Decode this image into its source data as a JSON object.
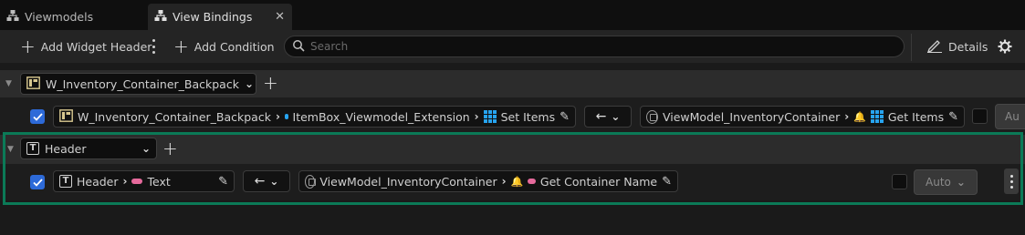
{
  "tabs": [
    {
      "label": "Viewmodels",
      "active": false
    },
    {
      "label": "View Bindings",
      "active": true
    }
  ],
  "toolbar": {
    "add_widget_header": "Add Widget Header",
    "add_condition": "Add Condition",
    "search_placeholder": "Search",
    "details": "Details"
  },
  "groups": [
    {
      "widget_name": "W_Inventory_Container_Backpack",
      "binding": {
        "checked": true,
        "source_widget": "W_Inventory_Container_Backpack",
        "source_property": "ItemBox_Viewmodel_Extension",
        "source_function": "Set Items",
        "direction": "←",
        "viewmodel": "ViewModel_InventoryContainer",
        "viewmodel_function": "Get Items",
        "mode": "Au"
      }
    },
    {
      "widget_name": "Header",
      "binding": {
        "checked": true,
        "source_widget": "Header",
        "source_property": "Text",
        "direction": "←",
        "viewmodel": "ViewModel_InventoryContainer",
        "viewmodel_function": "Get Container Name",
        "mode": "Auto"
      }
    }
  ],
  "colors": {
    "highlight": "#0b7a57",
    "checkbox": "#2d6ad8",
    "array_type": "#27a4f0",
    "text_type": "#e66a9c"
  }
}
